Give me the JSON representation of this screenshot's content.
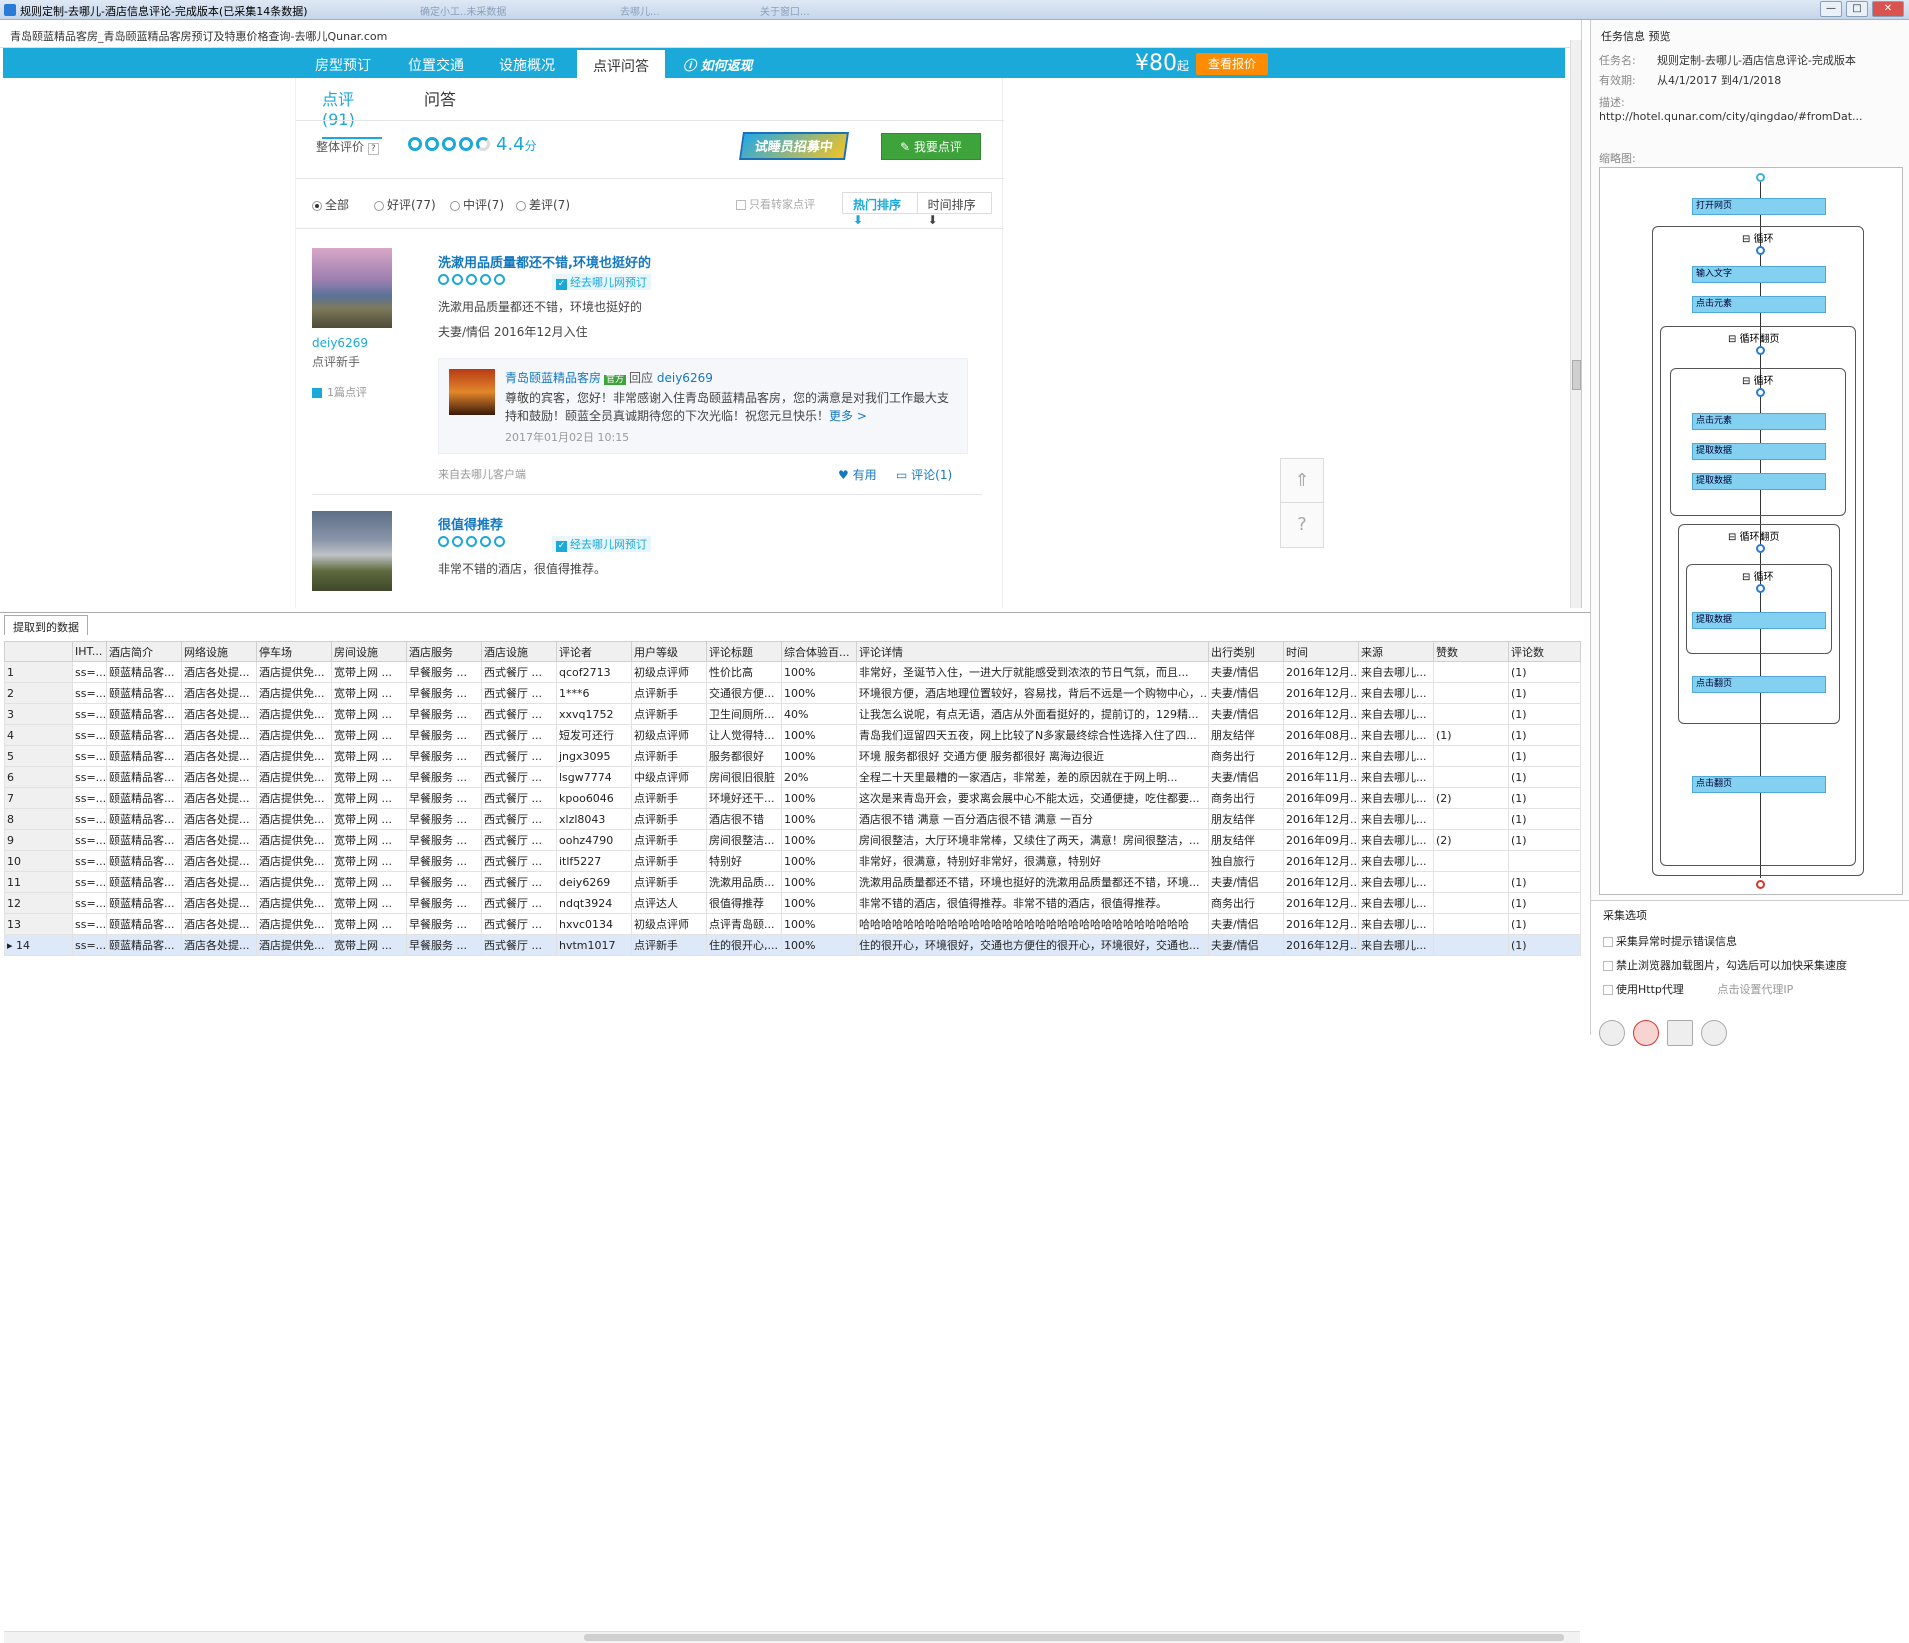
{
  "window": {
    "title": "规则定制-去哪儿-酒店信息评论-完成版本(已采集14条数据)",
    "ghost_tabs": [
      "确定小工..未采数据",
      "去哪儿...",
      "关于窗口..."
    ],
    "min": "—",
    "max": "□",
    "close": "✕"
  },
  "browser": {
    "address": "青岛颐蓝精品客房_青岛颐蓝精品客房预订及特惠价格查询-去哪儿Qunar.com",
    "nav_tabs": [
      "房型预订",
      "位置交通",
      "设施概况",
      "点评问答"
    ],
    "how_label": "如何返现",
    "price": "¥80",
    "price_suffix": "起",
    "quote_button": "查看报价",
    "sub_tabs": [
      "点评(91)",
      "问答"
    ],
    "score_label": "整体评价",
    "score_help": "?",
    "score_value": "4.4",
    "score_unit": "分",
    "recruit_label": "试睡员招募中",
    "write_review": "我要点评",
    "filters": [
      "全部",
      "好评(77)",
      "中评(7)",
      "差评(7)"
    ],
    "only_hotel": "只看转家点评",
    "sort_hot": "热门排序 ⬇",
    "sort_time": "时间排序 ⬇",
    "reviews": [
      {
        "title": "洗漱用品质量都还不错,环境也挺好的",
        "verified": "经去哪儿网预订",
        "text": "洗漱用品质量都还不错，环境也挺好的",
        "trip": "夫妻/情侣  2016年12月入住",
        "user": "deiy6269",
        "level": "点评新手",
        "count": "1篇点评",
        "reply_hotel": "青岛颐蓝精品客房",
        "reply_official": "官方",
        "reply_word": "回应",
        "reply_to": "deiy6269",
        "reply_text": "尊敬的宾客，您好！非常感谢入住青岛颐蓝精品客房，您的满意是对我们工作最大支持和鼓励！颐蓝全员真诚期待您的下次光临！祝您元旦快乐！",
        "reply_more": "更多 >",
        "reply_date": "2017年01月02日 10:15",
        "source": "来自去哪儿客户端",
        "useful": "♥ 有用",
        "comment": "评论(1)"
      },
      {
        "title": "很值得推荐",
        "verified": "经去哪儿网预订",
        "text": "非常不错的酒店，很值得推荐。"
      }
    ],
    "float_top": "⇑",
    "float_help": "?"
  },
  "grid": {
    "tab": "提取到的数据",
    "columns": [
      "",
      "IHT...",
      "酒店简介",
      "网络设施",
      "停车场",
      "房间设施",
      "酒店服务",
      "酒店设施",
      "评论者",
      "用户等级",
      "评论标题",
      "综合体验百...",
      "评论详情",
      "出行类别",
      "时间",
      "来源",
      "赞数",
      "评论数"
    ],
    "rows": [
      [
        "1",
        "ss=...",
        "颐蓝精品客...",
        "酒店各处提...",
        "酒店提供免...",
        "宽带上网 ...",
        "早餐服务 ...",
        "西式餐厅 ...",
        "qcof2713",
        "初级点评师",
        "性价比高",
        "100%",
        "非常好，圣诞节入住，一进大厅就能感受到浓浓的节日气氛，而且...",
        "夫妻/情侣",
        "2016年12月...",
        "来自去哪儿...",
        "",
        "(1)"
      ],
      [
        "2",
        "ss=...",
        "颐蓝精品客...",
        "酒店各处提...",
        "酒店提供免...",
        "宽带上网 ...",
        "早餐服务 ...",
        "西式餐厅 ...",
        "1***6",
        "点评新手",
        "交通很方便...",
        "100%",
        "环境很方便，酒店地理位置较好，容易找，背后不远是一个购物中心，...",
        "夫妻/情侣",
        "2016年12月...",
        "来自去哪儿...",
        "",
        "(1)"
      ],
      [
        "3",
        "ss=...",
        "颐蓝精品客...",
        "酒店各处提...",
        "酒店提供免...",
        "宽带上网 ...",
        "早餐服务 ...",
        "西式餐厅 ...",
        "xxvq1752",
        "点评新手",
        "卫生间厕所...",
        "40%",
        "让我怎么说呢，有点无语，酒店从外面看挺好的，提前订的，129精...",
        "夫妻/情侣",
        "2016年12月...",
        "来自去哪儿...",
        "",
        "(1)"
      ],
      [
        "4",
        "ss=...",
        "颐蓝精品客...",
        "酒店各处提...",
        "酒店提供免...",
        "宽带上网 ...",
        "早餐服务 ...",
        "西式餐厅 ...",
        "短发可还行",
        "初级点评师",
        "让人觉得特...",
        "100%",
        "青岛我们逗留四天五夜，网上比较了N多家最终综合性选择入住了四...",
        "朋友结伴",
        "2016年08月...",
        "来自去哪儿...",
        "(1)",
        "(1)"
      ],
      [
        "5",
        "ss=...",
        "颐蓝精品客...",
        "酒店各处提...",
        "酒店提供免...",
        "宽带上网 ...",
        "早餐服务 ...",
        "西式餐厅 ...",
        "jngx3095",
        "点评新手",
        "服务都很好",
        "100%",
        "环境 服务都很好 交通方便 服务都很好 离海边很近",
        "商务出行",
        "2016年12月...",
        "来自去哪儿...",
        "",
        "(1)"
      ],
      [
        "6",
        "ss=...",
        "颐蓝精品客...",
        "酒店各处提...",
        "酒店提供免...",
        "宽带上网 ...",
        "早餐服务 ...",
        "西式餐厅 ...",
        "lsgw7774",
        "中级点评师",
        "房间很旧很脏",
        "20%",
        "全程二十天里最糟的一家酒店，非常差，差的原因就在于网上明...",
        "夫妻/情侣",
        "2016年11月...",
        "来自去哪儿...",
        "",
        "(1)"
      ],
      [
        "7",
        "ss=...",
        "颐蓝精品客...",
        "酒店各处提...",
        "酒店提供免...",
        "宽带上网 ...",
        "早餐服务 ...",
        "西式餐厅 ...",
        "kpoo6046",
        "点评新手",
        "环境好还干...",
        "100%",
        "这次是来青岛开会，要求离会展中心不能太远，交通便捷，吃住都要...",
        "商务出行",
        "2016年09月...",
        "来自去哪儿...",
        "(2)",
        "(1)"
      ],
      [
        "8",
        "ss=...",
        "颐蓝精品客...",
        "酒店各处提...",
        "酒店提供免...",
        "宽带上网 ...",
        "早餐服务 ...",
        "西式餐厅 ...",
        "xlzl8043",
        "点评新手",
        "酒店很不错",
        "100%",
        "酒店很不错 满意 一百分酒店很不错 满意 一百分",
        "朋友结伴",
        "2016年12月...",
        "来自去哪儿...",
        "",
        "(1)"
      ],
      [
        "9",
        "ss=...",
        "颐蓝精品客...",
        "酒店各处提...",
        "酒店提供免...",
        "宽带上网 ...",
        "早餐服务 ...",
        "西式餐厅 ...",
        "oohz4790",
        "点评新手",
        "房间很整洁...",
        "100%",
        "房间很整洁，大厅环境非常棒，又续住了两天，满意！房间很整洁，...",
        "朋友结伴",
        "2016年09月...",
        "来自去哪儿...",
        "(2)",
        "(1)"
      ],
      [
        "10",
        "ss=...",
        "颐蓝精品客...",
        "酒店各处提...",
        "酒店提供免...",
        "宽带上网 ...",
        "早餐服务 ...",
        "西式餐厅 ...",
        "itlf5227",
        "点评新手",
        "特别好",
        "100%",
        "非常好，很满意，特别好非常好，很满意，特别好",
        "独自旅行",
        "2016年12月...",
        "来自去哪儿...",
        "",
        ""
      ],
      [
        "11",
        "ss=...",
        "颐蓝精品客...",
        "酒店各处提...",
        "酒店提供免...",
        "宽带上网 ...",
        "早餐服务 ...",
        "西式餐厅 ...",
        "deiy6269",
        "点评新手",
        "洗漱用品质...",
        "100%",
        "洗漱用品质量都还不错，环境也挺好的洗漱用品质量都还不错，环境...",
        "夫妻/情侣",
        "2016年12月...",
        "来自去哪儿...",
        "",
        "(1)"
      ],
      [
        "12",
        "ss=...",
        "颐蓝精品客...",
        "酒店各处提...",
        "酒店提供免...",
        "宽带上网 ...",
        "早餐服务 ...",
        "西式餐厅 ...",
        "ndqt3924",
        "点评达人",
        "很值得推荐",
        "100%",
        "非常不错的酒店，很值得推荐。非常不错的酒店，很值得推荐。",
        "商务出行",
        "2016年12月...",
        "来自去哪儿...",
        "",
        "(1)"
      ],
      [
        "13",
        "ss=...",
        "颐蓝精品客...",
        "酒店各处提...",
        "酒店提供免...",
        "宽带上网 ...",
        "早餐服务 ...",
        "西式餐厅 ...",
        "hxvc0134",
        "初级点评师",
        "点评青岛颐...",
        "100%",
        "哈哈哈哈哈哈哈哈哈哈哈哈哈哈哈哈哈哈哈哈哈哈哈哈哈哈哈哈哈哈",
        "夫妻/情侣",
        "2016年12月...",
        "来自去哪儿...",
        "",
        "(1)"
      ],
      [
        "▸ 14",
        "ss=...",
        "颐蓝精品客...",
        "酒店各处提...",
        "酒店提供免...",
        "宽带上网 ...",
        "早餐服务 ...",
        "西式餐厅 ...",
        "hvtm1017",
        "点评新手",
        "住的很开心,...",
        "100%",
        "住的很开心，环境很好，交通也方便住的很开心，环境很好，交通也...",
        "夫妻/情侣",
        "2016年12月...",
        "来自去哪儿...",
        "",
        "(1)"
      ]
    ]
  },
  "task": {
    "title": "任务信息 预览",
    "name_key": "任务名:",
    "name_val": "规则定制-去哪儿-酒店信息评论-完成版本",
    "valid_key": "有效期:",
    "valid_val": "从4/1/2017 到4/1/2018",
    "desc_key": "描述:",
    "desc_val": "http://hotel.qunar.com/city/qingdao/#fromDat...",
    "thumb_title": "缩略图:",
    "flow": {
      "open_page": "打开网页",
      "loop1": "循环",
      "input_text": "输入文字",
      "click1": "点击元素",
      "loop_page1": "循环翻页",
      "loop2": "循环",
      "click2": "点击元素",
      "extract1": "提取数据",
      "extract2": "提取数据",
      "loop_page2": "循环翻页",
      "loop3": "循环",
      "extract3": "提取数据",
      "click_page1": "点击翻页",
      "click_page2": "点击翻页"
    },
    "options_title": "采集选项",
    "opt1": "采集异常时提示错误信息",
    "opt2": "禁止浏览器加载图片，勾选后可以加快采集速度",
    "opt3": "使用Http代理",
    "opt3_link": "点击设置代理IP"
  },
  "colors": {
    "accent": "#1ba9d9",
    "orange": "#ff8c00",
    "green": "#3da33a"
  }
}
